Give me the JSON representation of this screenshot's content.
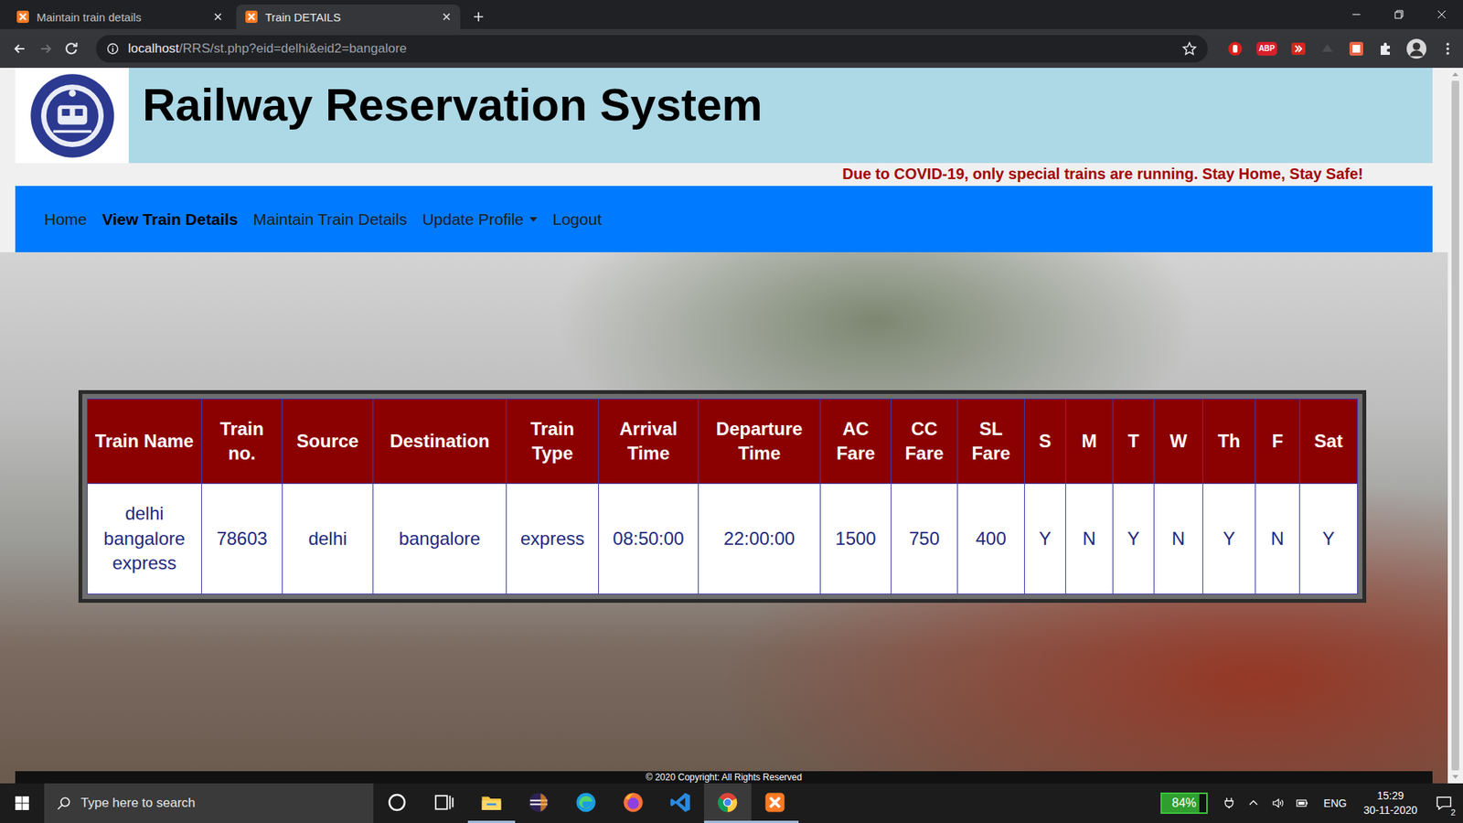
{
  "browser": {
    "tabs": [
      {
        "label": "Maintain train details",
        "selected": false
      },
      {
        "label": "Train DETAILS",
        "selected": true
      }
    ],
    "url_host": "localhost",
    "url_path": "/RRS/st.php?eid=delhi&eid2=bangalore",
    "extension_badge": "ABP"
  },
  "page": {
    "title": "Railway Reservation System",
    "notice": "Due to COVID-19, only special trains are running. Stay Home, Stay Safe!",
    "nav": [
      {
        "label": "Home",
        "selected": false,
        "dropdown": false
      },
      {
        "label": "View Train Details",
        "selected": true,
        "dropdown": false
      },
      {
        "label": "Maintain Train Details",
        "selected": false,
        "dropdown": false
      },
      {
        "label": "Update Profile",
        "selected": false,
        "dropdown": true
      },
      {
        "label": "Logout",
        "selected": false,
        "dropdown": false
      }
    ],
    "table": {
      "columns": [
        "Train Name",
        "Train no.",
        "Source",
        "Destination",
        "Train Type",
        "Arrival Time",
        "Departure Time",
        "AC Fare",
        "CC Fare",
        "SL Fare",
        "S",
        "M",
        "T",
        "W",
        "Th",
        "F",
        "Sat"
      ],
      "rows": [
        [
          "delhi bangalore express",
          "78603",
          "delhi",
          "bangalore",
          "express",
          "08:50:00",
          "22:00:00",
          "1500",
          "750",
          "400",
          "Y",
          "N",
          "Y",
          "N",
          "Y",
          "N",
          "Y"
        ]
      ]
    },
    "footer": "© 2020 Copyright: All Rights Reserved"
  },
  "taskbar": {
    "search_placeholder": "Type here to search",
    "apps": [
      {
        "kind": "cortana",
        "running": false,
        "selected": false
      },
      {
        "kind": "taskview",
        "running": false,
        "selected": false
      },
      {
        "kind": "explorer",
        "running": true,
        "selected": false
      },
      {
        "kind": "eclipse",
        "running": false,
        "selected": false
      },
      {
        "kind": "edge",
        "running": false,
        "selected": false
      },
      {
        "kind": "firefox",
        "running": false,
        "selected": false
      },
      {
        "kind": "vscode",
        "running": false,
        "selected": false
      },
      {
        "kind": "chrome",
        "running": true,
        "selected": true
      },
      {
        "kind": "xampp",
        "running": true,
        "selected": false
      }
    ],
    "battery": "84%",
    "battery_level": 0.84,
    "language": "ENG",
    "time": "15:29",
    "date": "30-11-2020",
    "notifications": "2"
  }
}
